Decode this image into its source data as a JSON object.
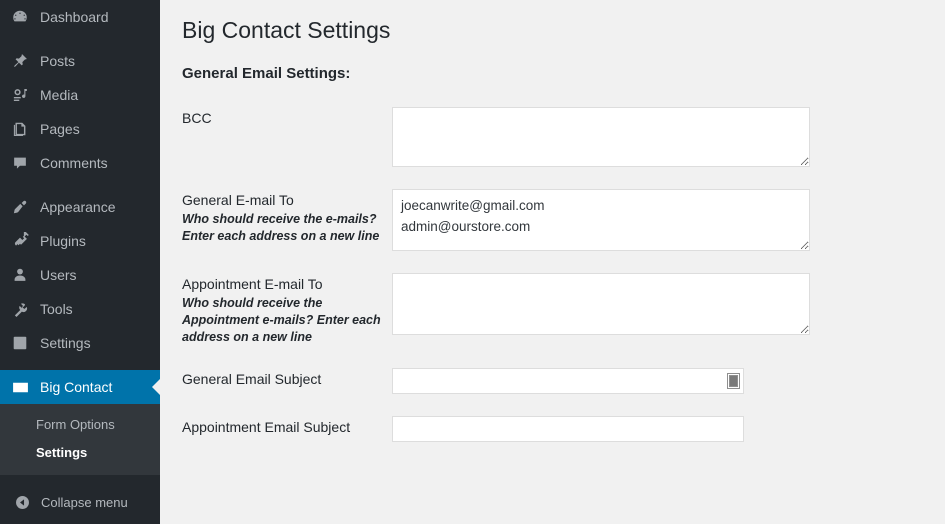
{
  "sidebar": {
    "items": [
      {
        "label": "Dashboard",
        "icon": "dashboard-icon",
        "spaced": false,
        "current": false
      },
      {
        "label": "Posts",
        "icon": "pin-icon",
        "spaced": true,
        "current": false
      },
      {
        "label": "Media",
        "icon": "media-icon",
        "spaced": false,
        "current": false
      },
      {
        "label": "Pages",
        "icon": "pages-icon",
        "spaced": false,
        "current": false
      },
      {
        "label": "Comments",
        "icon": "comments-icon",
        "spaced": false,
        "current": false
      },
      {
        "label": "Appearance",
        "icon": "brush-icon",
        "spaced": true,
        "current": false
      },
      {
        "label": "Plugins",
        "icon": "plug-icon",
        "spaced": false,
        "current": false
      },
      {
        "label": "Users",
        "icon": "user-icon",
        "spaced": false,
        "current": false
      },
      {
        "label": "Tools",
        "icon": "wrench-icon",
        "spaced": false,
        "current": false
      },
      {
        "label": "Settings",
        "icon": "sliders-icon",
        "spaced": false,
        "current": false
      },
      {
        "label": "Big Contact",
        "icon": "envelope-icon",
        "spaced": true,
        "current": true
      }
    ],
    "submenu": [
      {
        "label": "Form Options",
        "current": false
      },
      {
        "label": "Settings",
        "current": true
      }
    ],
    "collapse": {
      "label": "Collapse menu",
      "icon": "collapse-arrow-icon"
    },
    "colors": {
      "background": "#23282d",
      "submenu_background": "#32373c",
      "active": "#0073aa",
      "text": "#b4b9be"
    }
  },
  "main": {
    "page_title": "Big Contact Settings",
    "section_title": "General Email Settings:",
    "fields": [
      {
        "label": "BCC",
        "description": "",
        "type": "textarea",
        "value": "",
        "placeholder": ""
      },
      {
        "label": "General E-mail To",
        "description": "Who should receive the e-mails? Enter each address on a new line",
        "type": "textarea",
        "value": "joecanwrite@gmail.com\nadmin@ourstore.com",
        "placeholder": ""
      },
      {
        "label": "Appointment E-mail To",
        "description": "Who should receive the Appointment e-mails? Enter each address on a new line",
        "type": "textarea",
        "value": "",
        "placeholder": ""
      },
      {
        "label": "General Email Subject",
        "description": "",
        "type": "text",
        "value": "",
        "placeholder": "",
        "autofill_icon": "contact-card-icon"
      },
      {
        "label": "Appointment Email Subject",
        "description": "",
        "type": "text",
        "value": "",
        "placeholder": ""
      }
    ]
  }
}
